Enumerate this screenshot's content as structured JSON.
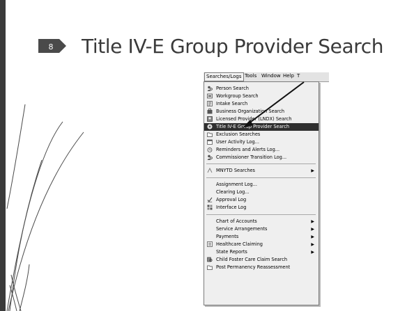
{
  "slide": {
    "number": "8",
    "title": "Title IV-E Group Provider Search"
  },
  "menubar": {
    "items": [
      "Searches/Logs",
      "Tools",
      "Window",
      "Help",
      "T"
    ]
  },
  "dropdown": {
    "items": [
      {
        "label": "Person Search",
        "icon": "person-search-icon"
      },
      {
        "label": "Workgroup Search",
        "icon": "workgroup-icon"
      },
      {
        "label": "Intake Search",
        "icon": "intake-icon"
      },
      {
        "label": "Business Organization Search",
        "icon": "business-icon"
      },
      {
        "label": "Licensed Provider (LNDX) Search",
        "icon": "provider-icon"
      },
      {
        "label": "Title IV-E Group Provider Search",
        "icon": "group-provider-icon",
        "selected": true
      },
      {
        "label": "Exclusion Searches",
        "icon": "folder-icon"
      },
      {
        "label": "User Activity Log...",
        "icon": "calendar-icon"
      },
      {
        "label": "Reminders and Alerts Log...",
        "icon": "alarm-icon"
      },
      {
        "label": "Commissioner Transition Log...",
        "icon": "person-log-icon"
      },
      {
        "label": "MNYTD Searches",
        "icon": "mnytd-icon",
        "submenu": true
      },
      {
        "label": "Assignment Log..."
      },
      {
        "label": "Clearing Log..."
      },
      {
        "label": "Approval Log",
        "icon": "approval-icon"
      },
      {
        "label": "Interface Log",
        "icon": "interface-icon"
      },
      {
        "label": "Chart of Accounts",
        "submenu": true
      },
      {
        "label": "Service Arrangements",
        "submenu": true
      },
      {
        "label": "Payments",
        "submenu": true
      },
      {
        "label": "Healthcare Claiming",
        "icon": "healthcare-icon",
        "submenu": true
      },
      {
        "label": "State Reports",
        "submenu": true
      },
      {
        "label": "Child Foster Care Claim Search",
        "icon": "claim-icon"
      },
      {
        "label": "Post Permanency Reassessment",
        "icon": "folder-icon"
      }
    ]
  },
  "colors": {
    "accent": "#4a4a4a",
    "selected_bg": "#2f2f2f",
    "menu_bg": "#efefef"
  }
}
